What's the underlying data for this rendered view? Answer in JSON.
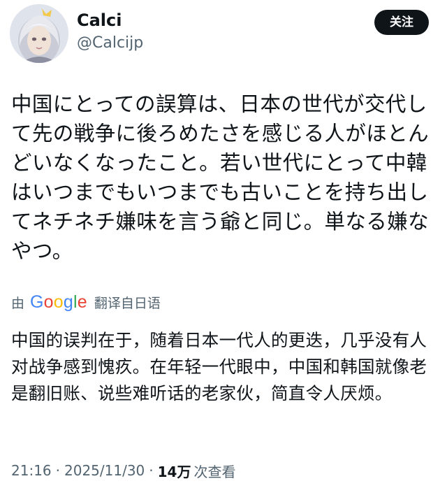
{
  "header": {
    "display_name": "Calci",
    "handle": "@Calcijp",
    "follow_label": "关注"
  },
  "tweet": {
    "text": "中国にとっての誤算は、日本の世代が交代して先の戦争に後ろめたさを感じる人がほとんどいなくなったこと。若い世代にとって中韓はいつまでもいつまでも古いことを持ち出してネチネチ嫌味を言う爺と同じ。単なる嫌なやつ。"
  },
  "translation": {
    "by": "由",
    "logo_letters": [
      "G",
      "o",
      "o",
      "g",
      "l",
      "e"
    ],
    "label": "翻译自日语",
    "text": "中国的误判在于，随着日本一代人的更迭，几乎没有人对战争感到愧疚。在年轻一代眼中，中国和韩国就像老是翻旧账、说些难听话的老家伙，简直令人厌烦。"
  },
  "meta": {
    "time": "21:16",
    "separator": "·",
    "date": "2025/11/30",
    "views_count": "14万",
    "views_label": "次查看"
  },
  "colors": {
    "text_primary": "#0f1419",
    "text_secondary": "#536471",
    "follow_button_bg": "#0f1419",
    "google_blue": "#4285f4",
    "google_red": "#ea4335",
    "google_yellow": "#fbbc05",
    "google_green": "#34a853"
  }
}
